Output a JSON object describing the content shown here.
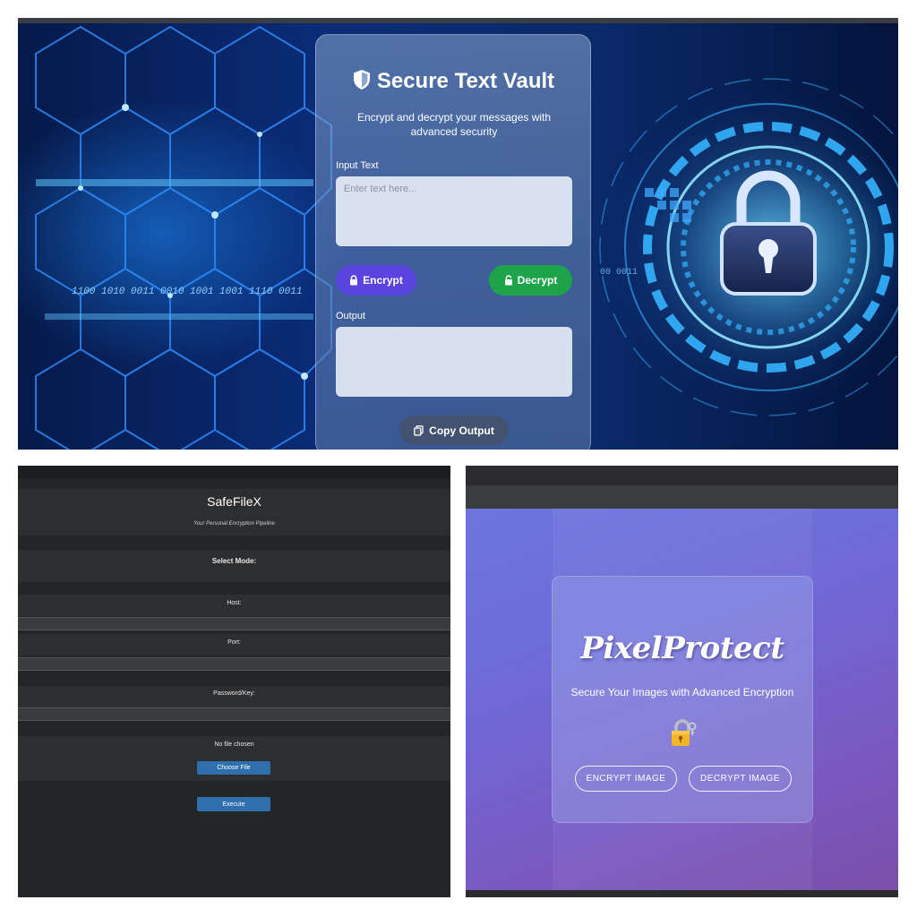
{
  "vault": {
    "title": "Secure Text Vault",
    "subtitle": "Encrypt and decrypt your messages with advanced security",
    "input_label": "Input Text",
    "input_placeholder": "Enter text here...",
    "encrypt_label": "Encrypt",
    "decrypt_label": "Decrypt",
    "output_label": "Output",
    "copy_label": "Copy Output",
    "binary_text": "1100 1010 0011 0010 1001 1001 1110 0011",
    "binary_text_right": "00 0011",
    "colors": {
      "encrypt": "#5b43e0",
      "decrypt": "#1da34a"
    }
  },
  "safefile": {
    "title": "SafeFileX",
    "tagline": "Your Personal Encryption Pipeline",
    "mode_label": "Select Mode:",
    "host_label": "Host:",
    "port_label": "Port:",
    "password_label": "Password/Key:",
    "file_status": "No file chosen",
    "choose_file_label": "Choose File",
    "execute_label": "Execute"
  },
  "pixel": {
    "title": "PixelProtect",
    "subtitle": "Secure Your Images with Advanced Encryption",
    "lock_icon": "lock-key-icon",
    "encrypt_label": "ENCRYPT IMAGE",
    "decrypt_label": "DECRYPT IMAGE"
  }
}
